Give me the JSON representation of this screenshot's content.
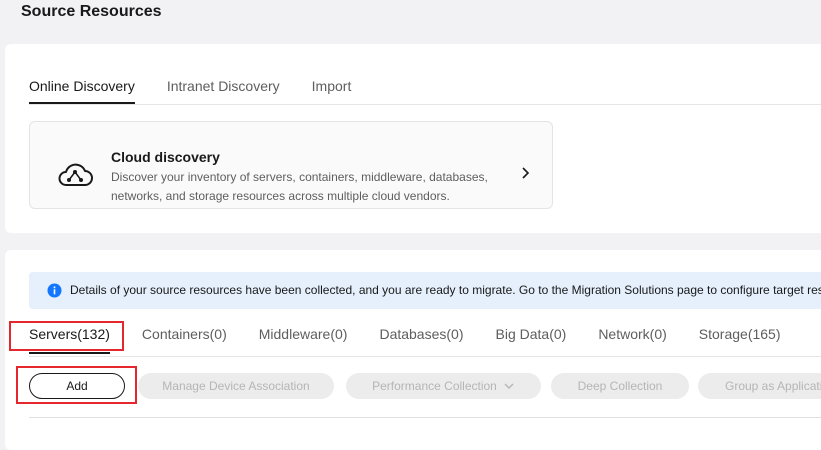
{
  "page": {
    "title": "Source Resources"
  },
  "discovery_tabs": [
    {
      "label": "Online Discovery",
      "active": true
    },
    {
      "label": "Intranet Discovery",
      "active": false
    },
    {
      "label": "Import",
      "active": false
    }
  ],
  "cloud_card": {
    "icon": "cloud-network-icon",
    "title": "Cloud discovery",
    "description": "Discover your inventory of servers, containers, middleware, databases, networks, and storage resources across multiple cloud vendors."
  },
  "info_banner": {
    "icon": "info-icon",
    "text": "Details of your source resources have been collected, and you are ready to migrate. Go to the Migration Solutions page to configure target res"
  },
  "resource_tabs": [
    {
      "label": "Servers(132)",
      "active": true
    },
    {
      "label": "Containers(0)",
      "active": false
    },
    {
      "label": "Middleware(0)",
      "active": false
    },
    {
      "label": "Databases(0)",
      "active": false
    },
    {
      "label": "Big Data(0)",
      "active": false
    },
    {
      "label": "Network(0)",
      "active": false
    },
    {
      "label": "Storage(165)",
      "active": false
    }
  ],
  "toolbar": {
    "add_label": "Add",
    "manage_label": "Manage Device Association",
    "perf_label": "Performance Collection",
    "deep_label": "Deep Collection",
    "group_label": "Group as Applicati"
  },
  "colors": {
    "highlight": "#e6262d",
    "info_bg": "#e5f0fc",
    "info_icon": "#1476ff"
  }
}
